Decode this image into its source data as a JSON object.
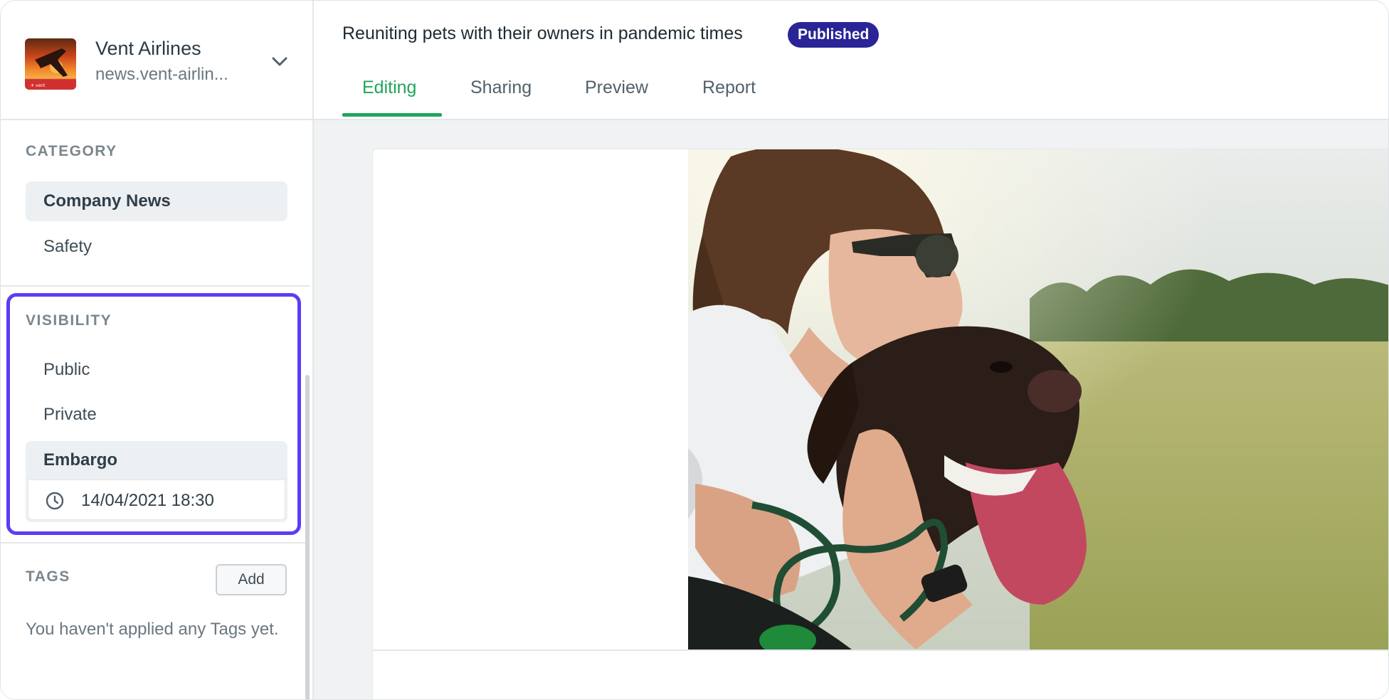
{
  "brand": {
    "name": "Vent Airlines",
    "domain": "news.vent-airlin..."
  },
  "sidebar": {
    "category": {
      "title": "CATEGORY",
      "items": [
        {
          "label": "Company News",
          "active": true
        },
        {
          "label": "Safety",
          "active": false
        }
      ]
    },
    "visibility": {
      "title": "VISIBILITY",
      "items": [
        {
          "label": "Public"
        },
        {
          "label": "Private"
        },
        {
          "label": "Embargo",
          "selected": true
        }
      ],
      "embargo_date": "14/04/2021 18:30"
    },
    "tags": {
      "title": "TAGS",
      "add_label": "Add",
      "empty_text": "You haven't applied any Tags yet."
    }
  },
  "header": {
    "title": "Reuniting pets with their owners in pandemic times",
    "status_badge": "Published",
    "tabs": [
      {
        "label": "Editing",
        "active": true
      },
      {
        "label": "Sharing"
      },
      {
        "label": "Preview"
      },
      {
        "label": "Report"
      }
    ]
  },
  "colors": {
    "accent_green": "#1fa65a",
    "badge_navy": "#2a2496",
    "highlight_purple": "#5b3df5"
  }
}
